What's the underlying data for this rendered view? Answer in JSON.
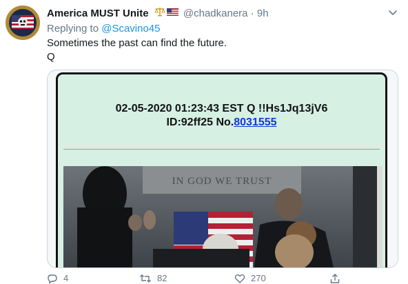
{
  "tweet": {
    "author_name": "America MUST Unite",
    "author_handle": "@chadkanera",
    "separator": "·",
    "time": "9h",
    "reply_prefix": "Replying to ",
    "reply_to": "@Scavino45",
    "text_line1": "Sometimes the past can find the future.",
    "text_line2": "Q",
    "avatar_text": "Q ARMY",
    "icons": [
      "scales-icon",
      "us-flag-icon",
      "chevron-down-icon",
      "reply-icon",
      "retweet-icon",
      "like-icon",
      "share-icon"
    ]
  },
  "media": {
    "post_line1": "02-05-2020 01:23:43 EST Q !!Hs1Jq13jV6",
    "post_line2_prefix": "ID:92ff25 No.",
    "post_link": "8031555",
    "engraving": "IN GOD WE TRUST"
  },
  "actions": {
    "replies": "4",
    "retweets": "82",
    "likes": "270"
  },
  "colors": {
    "link": "#1b95e0",
    "muted": "#657786",
    "post_background": "#d6f0e4",
    "post_link": "#0b3bd6"
  }
}
